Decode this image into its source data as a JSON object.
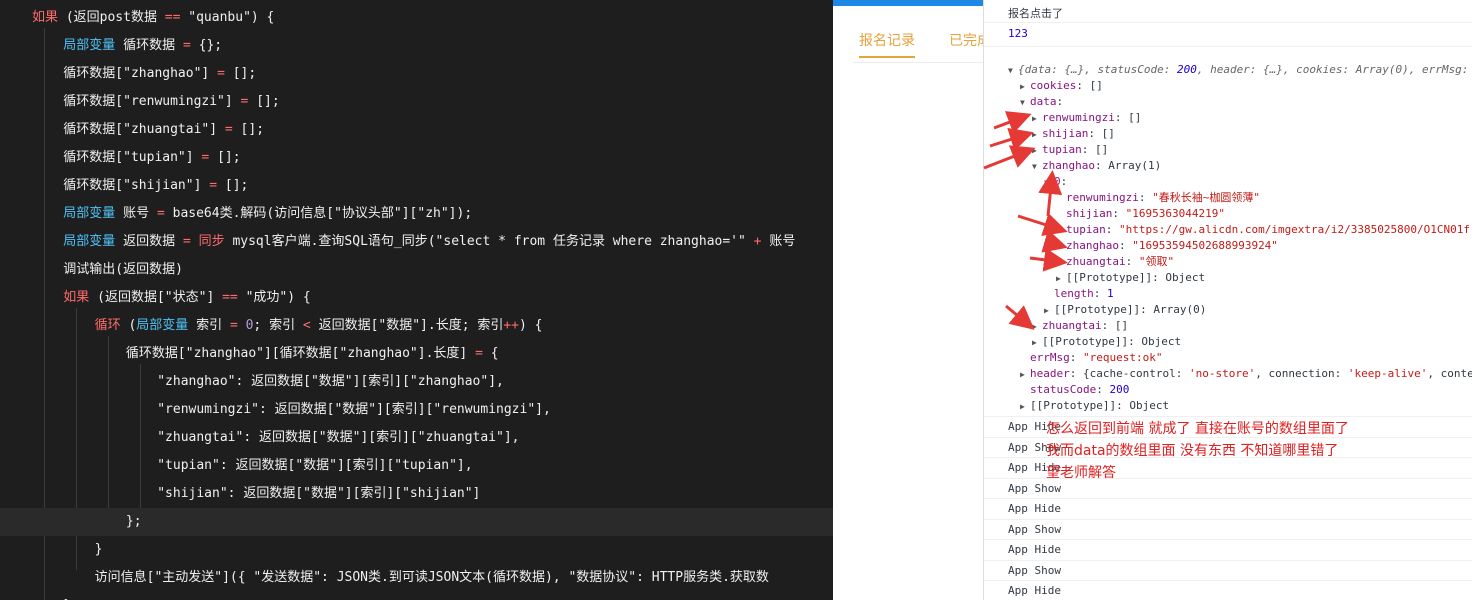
{
  "colors": {
    "keyword": "#d9534f",
    "variable": "#e8e8e8",
    "string": "#e8e8e8",
    "object_key": "#881280",
    "console_string": "#c41a16",
    "console_number": "#1c00cf",
    "annotation": "#e02020",
    "tab": "#e6a23c"
  },
  "code_lines": [
    [
      {
        "t": "如果 ",
        "c": "#ff6b6b"
      },
      {
        "t": "(返回post数据 ",
        "c": "#f0f0f0"
      },
      {
        "t": "== ",
        "c": "#ff6b6b"
      },
      {
        "t": "\"quanbu\") {",
        "c": "#f0f0f0"
      }
    ],
    [
      {
        "t": "    局部变量 ",
        "c": "#4fc3f7"
      },
      {
        "t": "循环数据 ",
        "c": "#f0f0f0"
      },
      {
        "t": "= ",
        "c": "#ff6b6b"
      },
      {
        "t": "{};",
        "c": "#f0f0f0"
      }
    ],
    [
      {
        "t": "    循环数据[\"zhanghao\"] ",
        "c": "#f0f0f0"
      },
      {
        "t": "= ",
        "c": "#ff6b6b"
      },
      {
        "t": "[];",
        "c": "#f0f0f0"
      }
    ],
    [
      {
        "t": "    循环数据[\"renwumingzi\"] ",
        "c": "#f0f0f0"
      },
      {
        "t": "= ",
        "c": "#ff6b6b"
      },
      {
        "t": "[];",
        "c": "#f0f0f0"
      }
    ],
    [
      {
        "t": "    循环数据[\"zhuangtai\"] ",
        "c": "#f0f0f0"
      },
      {
        "t": "= ",
        "c": "#ff6b6b"
      },
      {
        "t": "[];",
        "c": "#f0f0f0"
      }
    ],
    [
      {
        "t": "    循环数据[\"tupian\"] ",
        "c": "#f0f0f0"
      },
      {
        "t": "= ",
        "c": "#ff6b6b"
      },
      {
        "t": "[];",
        "c": "#f0f0f0"
      }
    ],
    [
      {
        "t": "    循环数据[\"shijian\"] ",
        "c": "#f0f0f0"
      },
      {
        "t": "= ",
        "c": "#ff6b6b"
      },
      {
        "t": "[];",
        "c": "#f0f0f0"
      }
    ],
    [
      {
        "t": "    局部变量 ",
        "c": "#4fc3f7"
      },
      {
        "t": "账号 ",
        "c": "#f0f0f0"
      },
      {
        "t": "= ",
        "c": "#ff6b6b"
      },
      {
        "t": "base64类.解码(访问信息[\"协议头部\"][\"zh\"]);",
        "c": "#f0f0f0"
      }
    ],
    [
      {
        "t": "    局部变量 ",
        "c": "#4fc3f7"
      },
      {
        "t": "返回数据 ",
        "c": "#f0f0f0"
      },
      {
        "t": "= ",
        "c": "#ff6b6b"
      },
      {
        "t": "同步 ",
        "c": "#ff6b6b"
      },
      {
        "t": "mysql客户端.查询SQL语句_同步(\"select * from 任务记录 where zhanghao='\" ",
        "c": "#f0f0f0"
      },
      {
        "t": "+ ",
        "c": "#ff6b6b"
      },
      {
        "t": "账号",
        "c": "#f0f0f0"
      }
    ],
    [
      {
        "t": "    调试输出(返回数据)",
        "c": "#f0f0f0"
      }
    ],
    [
      {
        "t": "    如果 ",
        "c": "#ff6b6b"
      },
      {
        "t": "(返回数据[\"状态\"] ",
        "c": "#f0f0f0"
      },
      {
        "t": "== ",
        "c": "#ff6b6b"
      },
      {
        "t": "\"成功\") {",
        "c": "#f0f0f0"
      }
    ],
    [
      {
        "t": "        循环 ",
        "c": "#ff6b6b"
      },
      {
        "t": "(",
        "c": "#f0f0f0"
      },
      {
        "t": "局部变量 ",
        "c": "#4fc3f7"
      },
      {
        "t": "索引 ",
        "c": "#f0f0f0"
      },
      {
        "t": "= ",
        "c": "#ff6b6b"
      },
      {
        "t": "0",
        "c": "#b39ddb"
      },
      {
        "t": "; 索引 ",
        "c": "#f0f0f0"
      },
      {
        "t": "< ",
        "c": "#ff6b6b"
      },
      {
        "t": "返回数据[\"数据\"].长度; 索引",
        "c": "#f0f0f0"
      },
      {
        "t": "++",
        "c": "#ff6b6b"
      },
      {
        "t": ") {",
        "c": "#f0f0f0"
      }
    ],
    [
      {
        "t": "            循环数据[\"zhanghao\"][循环数据[\"zhanghao\"].长度] ",
        "c": "#f0f0f0"
      },
      {
        "t": "= ",
        "c": "#ff6b6b"
      },
      {
        "t": "{",
        "c": "#f0f0f0"
      }
    ],
    [
      {
        "t": "                \"zhanghao\": 返回数据[\"数据\"][索引][\"zhanghao\"],",
        "c": "#f0f0f0"
      }
    ],
    [
      {
        "t": "                \"renwumingzi\": 返回数据[\"数据\"][索引][\"renwumingzi\"],",
        "c": "#f0f0f0"
      }
    ],
    [
      {
        "t": "                \"zhuangtai\": 返回数据[\"数据\"][索引][\"zhuangtai\"],",
        "c": "#f0f0f0"
      }
    ],
    [
      {
        "t": "                \"tupian\": 返回数据[\"数据\"][索引][\"tupian\"],",
        "c": "#f0f0f0"
      }
    ],
    [
      {
        "t": "                \"shijian\": 返回数据[\"数据\"][索引][\"shijian\"]",
        "c": "#f0f0f0"
      }
    ],
    [
      {
        "t": "            };",
        "c": "#f0f0f0"
      }
    ],
    [
      {
        "t": "        }",
        "c": "#f0f0f0"
      }
    ],
    [
      {
        "t": "        访问信息[\"主动发送\"]({ \"发送数据\": JSON类.到可读JSON文本(循环数据), \"数据协议\": HTTP服务类.获取数",
        "c": "#f0f0f0"
      }
    ],
    [
      {
        "t": "    }",
        "c": "#f0f0f0"
      }
    ]
  ],
  "preview": {
    "tab_records": "报名记录",
    "tab_done": "已完成"
  },
  "console": {
    "log1": "报名点击了",
    "log2": "123",
    "tree": [
      {
        "indent": 0,
        "arrow": "▼",
        "parts": [
          {
            "t": "{data: {…}, statusCode: ",
            "c": "gray"
          },
          {
            "t": "200",
            "c": "num"
          },
          {
            "t": ", header: {…}, cookies: Array(0), errMsg: ",
            "c": "gray"
          }
        ],
        "italic": true
      },
      {
        "indent": 1,
        "arrow": "▶",
        "parts": [
          {
            "t": "cookies",
            "c": "key"
          },
          {
            "t": ": []",
            "c": ""
          }
        ]
      },
      {
        "indent": 1,
        "arrow": "▼",
        "parts": [
          {
            "t": "data",
            "c": "key"
          },
          {
            "t": ":",
            "c": ""
          }
        ]
      },
      {
        "indent": 2,
        "arrow": "▶",
        "parts": [
          {
            "t": "renwumingzi",
            "c": "key"
          },
          {
            "t": ": []",
            "c": ""
          }
        ]
      },
      {
        "indent": 2,
        "arrow": "▶",
        "parts": [
          {
            "t": "shijian",
            "c": "key"
          },
          {
            "t": ": []",
            "c": ""
          }
        ]
      },
      {
        "indent": 2,
        "arrow": "▶",
        "parts": [
          {
            "t": "tupian",
            "c": "key"
          },
          {
            "t": ": []",
            "c": ""
          }
        ]
      },
      {
        "indent": 2,
        "arrow": "▼",
        "parts": [
          {
            "t": "zhanghao",
            "c": "key"
          },
          {
            "t": ": Array(1)",
            "c": ""
          }
        ]
      },
      {
        "indent": 3,
        "arrow": "▼",
        "parts": [
          {
            "t": "0",
            "c": "key"
          },
          {
            "t": ":",
            "c": ""
          }
        ]
      },
      {
        "indent": 4,
        "arrow": "",
        "parts": [
          {
            "t": "renwumingzi",
            "c": "key"
          },
          {
            "t": ": ",
            "c": ""
          },
          {
            "t": "\"春秋长袖~枷圆领薄\"",
            "c": "str"
          }
        ]
      },
      {
        "indent": 4,
        "arrow": "",
        "parts": [
          {
            "t": "shijian",
            "c": "key"
          },
          {
            "t": ": ",
            "c": ""
          },
          {
            "t": "\"1695363044219\"",
            "c": "str"
          }
        ]
      },
      {
        "indent": 4,
        "arrow": "",
        "parts": [
          {
            "t": "tupian",
            "c": "key"
          },
          {
            "t": ": ",
            "c": ""
          },
          {
            "t": "\"https://gw.alicdn.com/imgextra/i2/3385025800/O1CN01f",
            "c": "str"
          }
        ]
      },
      {
        "indent": 4,
        "arrow": "",
        "parts": [
          {
            "t": "zhanghao",
            "c": "key"
          },
          {
            "t": ": ",
            "c": ""
          },
          {
            "t": "\"16953594502688993924\"",
            "c": "str"
          }
        ]
      },
      {
        "indent": 4,
        "arrow": "",
        "parts": [
          {
            "t": "zhuangtai",
            "c": "key"
          },
          {
            "t": ": ",
            "c": ""
          },
          {
            "t": "\"领取\"",
            "c": "str"
          }
        ]
      },
      {
        "indent": 4,
        "arrow": "▶",
        "parts": [
          {
            "t": "[[Prototype]]: Object",
            "c": ""
          }
        ]
      },
      {
        "indent": 3,
        "arrow": "",
        "parts": [
          {
            "t": "length",
            "c": "key"
          },
          {
            "t": ": ",
            "c": ""
          },
          {
            "t": "1",
            "c": "num"
          }
        ]
      },
      {
        "indent": 3,
        "arrow": "▶",
        "parts": [
          {
            "t": "[[Prototype]]: Array(0)",
            "c": ""
          }
        ]
      },
      {
        "indent": 2,
        "arrow": "▶",
        "parts": [
          {
            "t": "zhuangtai",
            "c": "key"
          },
          {
            "t": ": []",
            "c": ""
          }
        ]
      },
      {
        "indent": 2,
        "arrow": "▶",
        "parts": [
          {
            "t": "[[Prototype]]: Object",
            "c": ""
          }
        ]
      },
      {
        "indent": 1,
        "arrow": "",
        "parts": [
          {
            "t": "errMsg",
            "c": "key"
          },
          {
            "t": ": ",
            "c": ""
          },
          {
            "t": "\"request:ok\"",
            "c": "str"
          }
        ]
      },
      {
        "indent": 1,
        "arrow": "▶",
        "parts": [
          {
            "t": "header",
            "c": "key"
          },
          {
            "t": ": {cache-control: ",
            "c": ""
          },
          {
            "t": "'no-store'",
            "c": "str"
          },
          {
            "t": ", connection: ",
            "c": ""
          },
          {
            "t": "'keep-alive'",
            "c": "str"
          },
          {
            "t": ", conte",
            "c": ""
          }
        ]
      },
      {
        "indent": 1,
        "arrow": "",
        "parts": [
          {
            "t": "statusCode",
            "c": "key"
          },
          {
            "t": ": ",
            "c": ""
          },
          {
            "t": "200",
            "c": "num"
          }
        ]
      },
      {
        "indent": 1,
        "arrow": "▶",
        "parts": [
          {
            "t": "[[Prototype]]: Object",
            "c": ""
          }
        ]
      }
    ],
    "app_lines": [
      "App Hide",
      "App Show",
      "App Hide",
      "App Show",
      "App Hide",
      "App Show",
      "App Hide",
      "App Show",
      "App Hide"
    ]
  },
  "annotation": {
    "line1": "怎么返回到前端 就成了  直接在账号的数组里面了",
    "line2": "我而data的数组里面 没有东西  不知道哪里错了",
    "line3": "望老师解答"
  }
}
